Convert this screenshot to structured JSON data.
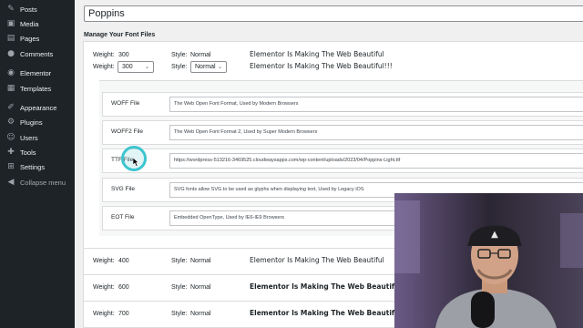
{
  "sidebar": {
    "items": [
      {
        "label": "Posts",
        "icon": "pin-icon",
        "glyph": "✎"
      },
      {
        "label": "Media",
        "icon": "media-icon",
        "glyph": "▣"
      },
      {
        "label": "Pages",
        "icon": "pages-icon",
        "glyph": "▤"
      },
      {
        "label": "Comments",
        "icon": "comments-icon",
        "glyph": "●"
      },
      {
        "label": "Elementor",
        "icon": "elementor-icon",
        "glyph": "◉"
      },
      {
        "label": "Templates",
        "icon": "templates-icon",
        "glyph": "▦"
      },
      {
        "label": "Appearance",
        "icon": "appearance-icon",
        "glyph": "✐"
      },
      {
        "label": "Plugins",
        "icon": "plugins-icon",
        "glyph": "⚙"
      },
      {
        "label": "Users",
        "icon": "users-icon",
        "glyph": "☺"
      },
      {
        "label": "Tools",
        "icon": "tools-icon",
        "glyph": "✚"
      },
      {
        "label": "Settings",
        "icon": "settings-icon",
        "glyph": "⊞"
      },
      {
        "label": "Collapse menu",
        "icon": "collapse-icon",
        "glyph": "◀"
      }
    ]
  },
  "font": {
    "name": "Poppins",
    "section_title": "Manage Your Font Files"
  },
  "first_variation": {
    "weight_label": "Weight:",
    "weight_value": "300",
    "style_label": "Style:",
    "style_value": "Normal",
    "weight_select": "300",
    "style_select": "Normal",
    "preview_1": "Elementor Is Making The Web Beautiful",
    "preview_2": "Elementor Is Making The Web Beautiful!!!"
  },
  "files": [
    {
      "label": "WOFF File",
      "value": "The Web Open Font Format, Used by Modern Browsers"
    },
    {
      "label": "WOFF2 File",
      "value": "The Web Open Font Format 2, Used by Super Modern Browsers"
    },
    {
      "label": "TTF File",
      "value": "https://wordpress-513216-3469525.cloudwaysapps.com/wp-content/uploads/2023/04/Poppins-Light.ttf"
    },
    {
      "label": "SVG File",
      "value": "SVG fonts allow SVG to be used as glyphs when displaying text, Used by Legacy iOS"
    },
    {
      "label": "EOT File",
      "value": "Embedded OpenType, Used by IE6-IE9 Browsers"
    }
  ],
  "variations": [
    {
      "weight_label": "Weight:",
      "weight": "400",
      "style_label": "Style:",
      "style": "Normal",
      "preview": "Elementor Is Making The Web Beautiful"
    },
    {
      "weight_label": "Weight:",
      "weight": "600",
      "style_label": "Style:",
      "style": "Normal",
      "preview": "Elementor Is Making The Web Beautiful"
    },
    {
      "weight_label": "Weight:",
      "weight": "700",
      "style_label": "Style:",
      "style": "Normal",
      "preview": "Elementor Is Making The Web Beautiful"
    }
  ]
}
